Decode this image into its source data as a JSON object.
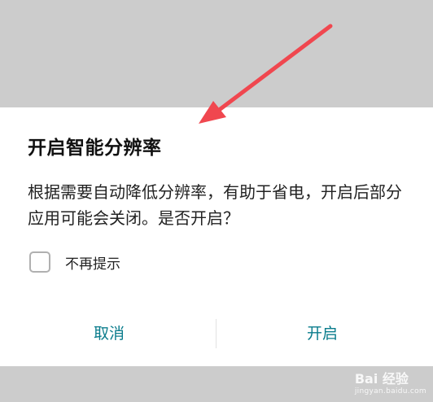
{
  "dialog": {
    "title": "开启智能分辨率",
    "message": "根据需要自动降低分辨率，有助于省电，开启后部分应用可能会关闭。是否开启？",
    "checkbox_label": "不再提示",
    "checkbox_checked": false,
    "cancel_label": "取消",
    "confirm_label": "开启"
  },
  "colors": {
    "accent": "#0a7c8c",
    "arrow": "#f0474f",
    "backdrop": "#cccccc"
  },
  "watermark": {
    "brand": "Bai 经验",
    "url": "jingyan.baidu.com"
  }
}
